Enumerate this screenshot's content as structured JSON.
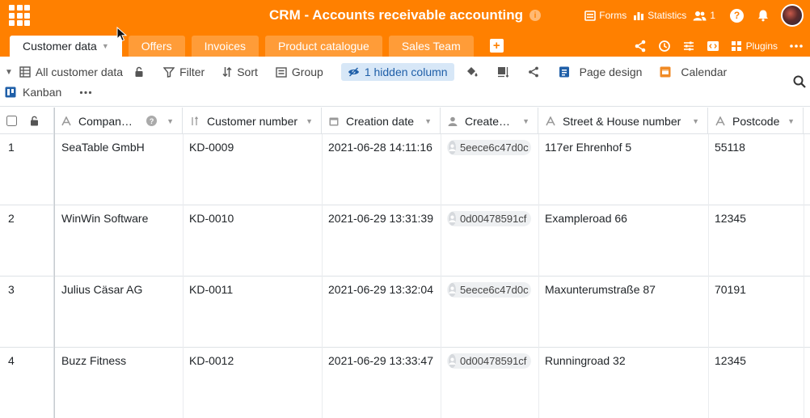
{
  "header": {
    "title": "CRM - Accounts receivable accounting",
    "forms": "Forms",
    "statistics": "Statistics",
    "collaborators_count": "1",
    "help": "?"
  },
  "tabs": [
    {
      "label": "Customer data",
      "active": true
    },
    {
      "label": "Offers"
    },
    {
      "label": "Invoices"
    },
    {
      "label": "Product catalogue"
    },
    {
      "label": "Sales Team"
    }
  ],
  "tab_toolbar": {
    "plugins": "Plugins"
  },
  "toolbar": {
    "view": "All customer data",
    "filter": "Filter",
    "sort": "Sort",
    "group": "Group",
    "hidden_columns": "1 hidden column",
    "page_design": "Page design",
    "calendar": "Calendar",
    "kanban": "Kanban"
  },
  "columns": [
    {
      "name": "Compan…",
      "icon": "text-icon"
    },
    {
      "name": "Customer number",
      "icon": "autonumber-icon"
    },
    {
      "name": "Creation date",
      "icon": "calendar-icon"
    },
    {
      "name": "Create…",
      "icon": "user-icon"
    },
    {
      "name": "Street & House number",
      "icon": "text-icon"
    },
    {
      "name": "Postcode",
      "icon": "text-icon"
    }
  ],
  "rows": [
    {
      "num": "1",
      "company": "SeaTable GmbH",
      "customer_number": "KD-0009",
      "creation_date": "2021-06-28 14:11:16",
      "creator": "5eece6c47d0c",
      "street": "117er Ehrenhof 5",
      "postcode": "55118"
    },
    {
      "num": "2",
      "company": "WinWin Software",
      "customer_number": "KD-0010",
      "creation_date": "2021-06-29 13:31:39",
      "creator": "0d00478591cf",
      "street": "Exampleroad 66",
      "postcode": "12345"
    },
    {
      "num": "3",
      "company": "Julius Cäsar AG",
      "customer_number": "KD-0011",
      "creation_date": "2021-06-29 13:32:04",
      "creator": "5eece6c47d0c",
      "street": "Maxunterumstraße 87",
      "postcode": "70191"
    },
    {
      "num": "4",
      "company": "Buzz Fitness",
      "customer_number": "KD-0012",
      "creation_date": "2021-06-29 13:33:47",
      "creator": "0d00478591cf",
      "street": "Runningroad 32",
      "postcode": "12345"
    }
  ],
  "colors": {
    "brand": "#ff8000",
    "hidden_badge_bg": "#d7e7f7",
    "hidden_badge_text": "#1f5fa8",
    "page_design": "#1f5fa8",
    "calendar": "#f08a24",
    "kanban": "#1f5fa8"
  }
}
